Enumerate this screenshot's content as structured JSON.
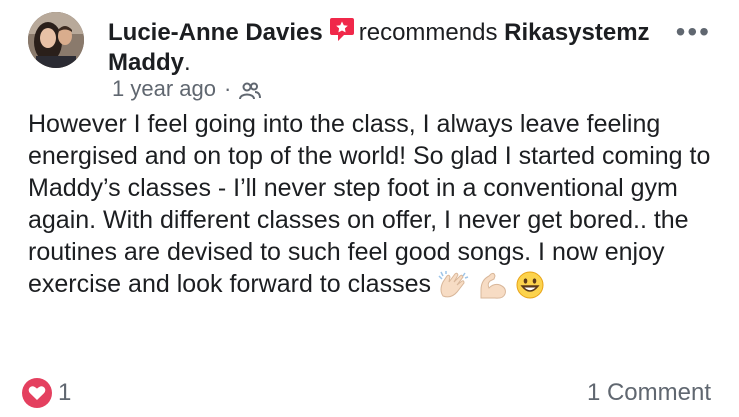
{
  "post": {
    "author": "Lucie-Anne Davies",
    "verb": "recommends",
    "page_name_line1": "Rikasystemz",
    "page_name_line2": "Maddy",
    "page_name_suffix": ".",
    "timestamp": "1 year ago",
    "separator": "·",
    "privacy_icon": "friends-icon",
    "more_label": "•••",
    "body": "However I feel going into the class, I always leave feeling energised and on top of the world! So glad I started coming to Maddy’s classes - I’ll never step foot in a conventional gym again. With different classes on offer, I never get bored.. the routines are devised to such feel good songs. I now enjoy exercise and look forward to classes",
    "emojis": [
      "clapping-hands-icon",
      "flexed-biceps-icon",
      "grinning-face-icon"
    ]
  },
  "footer": {
    "reaction_icon": "heart-icon",
    "reaction_count": "1",
    "comments": "1 Comment"
  },
  "colors": {
    "recommend_badge": "#f0284a",
    "love_reaction": "#e4405f",
    "meta_text": "#606770",
    "text": "#1c1e21"
  }
}
